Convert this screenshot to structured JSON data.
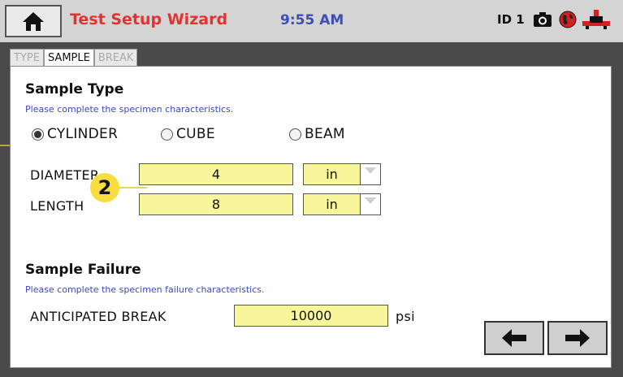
{
  "header": {
    "title": "Test Setup Wizard",
    "time": "9:55 AM",
    "id_label": "ID 1",
    "colors": {
      "title": "#e33232",
      "time": "#3d4fb5",
      "bar": "#d4d4d4"
    }
  },
  "tabs": [
    {
      "label": "TYPE",
      "active": false
    },
    {
      "label": "SAMPLE",
      "active": true
    },
    {
      "label": "BREAK",
      "active": false
    }
  ],
  "sample_type": {
    "heading": "Sample Type",
    "subtext": "Please complete the specimen characteristics.",
    "options": [
      {
        "label": "CYLINDER",
        "selected": true
      },
      {
        "label": "CUBE",
        "selected": false
      },
      {
        "label": "BEAM",
        "selected": false
      }
    ]
  },
  "dimensions": [
    {
      "label": "DIAMETER",
      "value": "4",
      "unit": "in"
    },
    {
      "label": "LENGTH",
      "value": "8",
      "unit": "in"
    }
  ],
  "sample_failure": {
    "heading": "Sample Failure",
    "subtext": "Please complete the specimen failure characteristics.",
    "break_label": "ANTICIPATED BREAK",
    "break_value": "10000",
    "break_unit": "psi"
  },
  "callouts": {
    "c2": "2"
  },
  "icons": [
    "home-icon",
    "camera-icon",
    "globe-icon",
    "plug-icon",
    "arrow-left-icon",
    "arrow-right-icon",
    "dropdown-arrow-icon"
  ]
}
